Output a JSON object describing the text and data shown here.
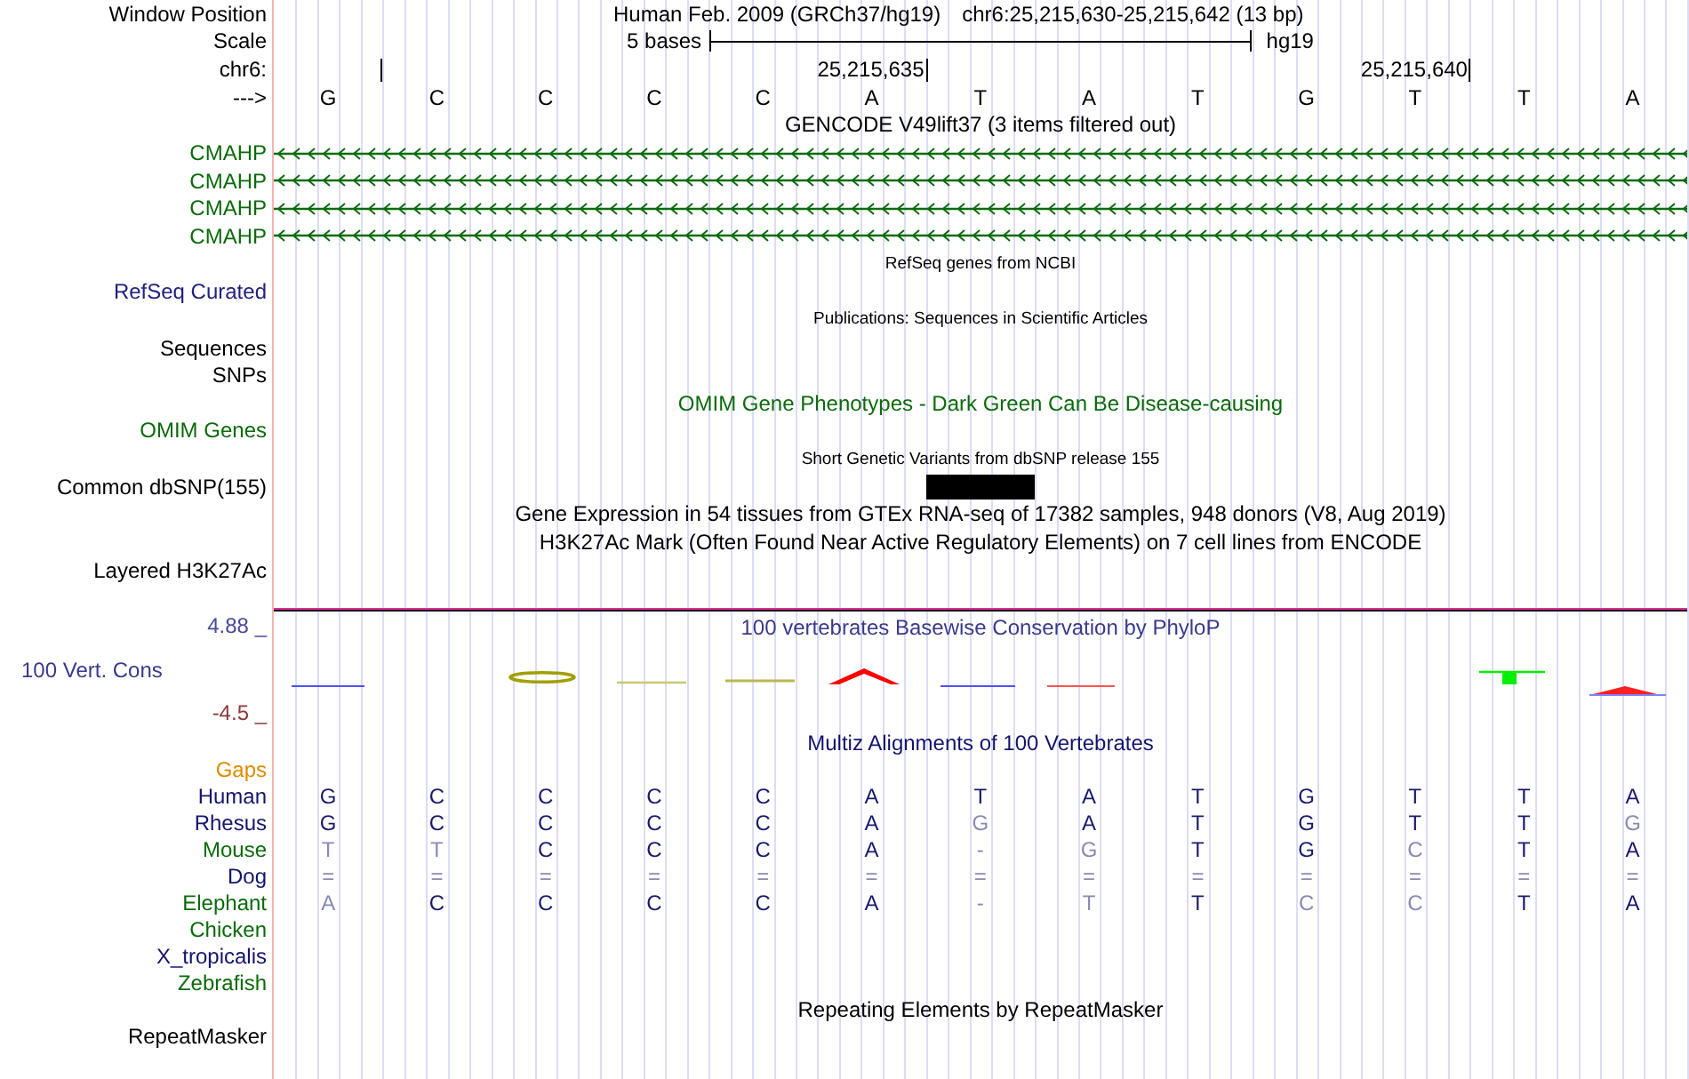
{
  "rows": [
    {
      "kind": "position",
      "label": "Window Position",
      "assembly": "Human Feb. 2009 (GRCh37/hg19)",
      "range": "chr6:25,215,630-25,215,642 (13 bp)"
    },
    {
      "kind": "scale",
      "label": "Scale",
      "text": "5 bases",
      "assembly": "hg19"
    },
    {
      "kind": "ruler",
      "label": "chr6:",
      "marks": [
        {
          "tick": true
        },
        {
          "tick": false
        },
        {
          "tick": false
        },
        {
          "tick": false
        },
        {
          "tick": false
        },
        {
          "tick": true,
          "label": "25,215,635"
        },
        {
          "tick": false
        },
        {
          "tick": false
        },
        {
          "tick": false
        },
        {
          "tick": false
        },
        {
          "tick": true,
          "label": "25,215,640"
        },
        {
          "tick": false
        },
        {
          "tick": false
        }
      ]
    },
    {
      "kind": "bases",
      "label": "--->",
      "bases": [
        "G",
        "C",
        "C",
        "C",
        "C",
        "A",
        "T",
        "A",
        "T",
        "G",
        "T",
        "T",
        "A"
      ]
    },
    {
      "kind": "title",
      "text": "GENCODE V49lift37 (3 items filtered out)",
      "color": "#000000"
    },
    {
      "kind": "gene",
      "label": "CMAHP",
      "color": "#0b6b0b"
    },
    {
      "kind": "gene",
      "label": "CMAHP",
      "color": "#0b6b0b"
    },
    {
      "kind": "gene",
      "label": "CMAHP",
      "color": "#0b6b0b"
    },
    {
      "kind": "gene",
      "label": "CMAHP",
      "color": "#0b6b0b"
    },
    {
      "kind": "note",
      "text": "RefSeq genes from NCBI"
    },
    {
      "kind": "label",
      "label": "RefSeq Curated",
      "color": "#202080"
    },
    {
      "kind": "note",
      "text": "Publications: Sequences in Scientific Articles"
    },
    {
      "kind": "label",
      "label": "Sequences",
      "color": "#000000"
    },
    {
      "kind": "label",
      "label": "SNPs",
      "color": "#000000"
    },
    {
      "kind": "title",
      "text": "OMIM Gene Phenotypes - Dark Green Can Be Disease-causing",
      "color": "#0b6b0b"
    },
    {
      "kind": "label",
      "label": "OMIM Genes",
      "color": "#0b6b0b"
    },
    {
      "kind": "note",
      "text": "Short Genetic Variants from dbSNP release 155"
    },
    {
      "kind": "snp",
      "label": "Common dbSNP(155)",
      "color": "#000000",
      "marks": [
        {
          "filled": false
        },
        {
          "filled": false
        },
        {
          "filled": false
        },
        {
          "filled": false
        },
        {
          "filled": false
        },
        {
          "filled": false
        },
        {
          "filled": true
        },
        {
          "filled": false
        },
        {
          "filled": false
        },
        {
          "filled": false
        },
        {
          "filled": false
        },
        {
          "filled": false
        },
        {
          "filled": false
        }
      ]
    },
    {
      "kind": "title",
      "text": "Gene Expression in 54 tissues from GTEx RNA-seq of 17382 samples, 948 donors (V8, Aug 2019)",
      "color": "#000000"
    },
    {
      "kind": "title",
      "text": "H3K27Ac Mark (Often Found Near Active Regulatory Elements) on 7 cell lines from ENCODE",
      "color": "#000000"
    },
    {
      "kind": "label",
      "label": "Layered H3K27Ac",
      "color": "#000000"
    },
    {
      "kind": "conservation",
      "label": "100 Vert. Cons",
      "color": "#3a3a8c",
      "max": "4.88 _",
      "min": "-4.5 _",
      "title": "100 vertebrates Basewise Conservation by PhyloP"
    },
    {
      "kind": "title",
      "text": "Multiz Alignments of 100 Vertebrates",
      "color": "#14146e"
    },
    {
      "kind": "label",
      "label": "Gaps",
      "color": "#e08a00"
    },
    {
      "kind": "alignment",
      "label": "Human",
      "color": "#14146e",
      "bases": [
        {
          "base": "G",
          "match": true
        },
        {
          "base": "C",
          "match": true
        },
        {
          "base": "C",
          "match": true
        },
        {
          "base": "C",
          "match": true
        },
        {
          "base": "C",
          "match": true
        },
        {
          "base": "A",
          "match": true
        },
        {
          "base": "T",
          "match": true
        },
        {
          "base": "A",
          "match": true
        },
        {
          "base": "T",
          "match": true
        },
        {
          "base": "G",
          "match": true
        },
        {
          "base": "T",
          "match": true
        },
        {
          "base": "T",
          "match": true
        },
        {
          "base": "A",
          "match": true
        }
      ]
    },
    {
      "kind": "alignment",
      "label": "Rhesus",
      "color": "#14146e",
      "bases": [
        {
          "base": "G",
          "match": true
        },
        {
          "base": "C",
          "match": true
        },
        {
          "base": "C",
          "match": true
        },
        {
          "base": "C",
          "match": true
        },
        {
          "base": "C",
          "match": true
        },
        {
          "base": "A",
          "match": true
        },
        {
          "base": "G",
          "match": false
        },
        {
          "base": "A",
          "match": true
        },
        {
          "base": "T",
          "match": true
        },
        {
          "base": "G",
          "match": true
        },
        {
          "base": "T",
          "match": true
        },
        {
          "base": "T",
          "match": true
        },
        {
          "base": "G",
          "match": false
        }
      ]
    },
    {
      "kind": "alignment",
      "label": "Mouse",
      "color": "#0b6b0b",
      "bases": [
        {
          "base": "T",
          "match": false
        },
        {
          "base": "T",
          "match": false
        },
        {
          "base": "C",
          "match": true
        },
        {
          "base": "C",
          "match": true
        },
        {
          "base": "C",
          "match": true
        },
        {
          "base": "A",
          "match": true
        },
        {
          "base": "-",
          "match": false
        },
        {
          "base": "G",
          "match": false
        },
        {
          "base": "T",
          "match": true
        },
        {
          "base": "G",
          "match": true
        },
        {
          "base": "C",
          "match": false
        },
        {
          "base": "T",
          "match": true
        },
        {
          "base": "A",
          "match": true
        }
      ]
    },
    {
      "kind": "alignment",
      "label": "Dog",
      "color": "#14146e",
      "bases": [
        {
          "base": "=",
          "match": false
        },
        {
          "base": "=",
          "match": false
        },
        {
          "base": "=",
          "match": false
        },
        {
          "base": "=",
          "match": false
        },
        {
          "base": "=",
          "match": false
        },
        {
          "base": "=",
          "match": false
        },
        {
          "base": "=",
          "match": false
        },
        {
          "base": "=",
          "match": false
        },
        {
          "base": "=",
          "match": false
        },
        {
          "base": "=",
          "match": false
        },
        {
          "base": "=",
          "match": false
        },
        {
          "base": "=",
          "match": false
        },
        {
          "base": "=",
          "match": false
        }
      ]
    },
    {
      "kind": "alignment",
      "label": "Elephant",
      "color": "#0b6b0b",
      "bases": [
        {
          "base": "A",
          "match": false
        },
        {
          "base": "C",
          "match": true
        },
        {
          "base": "C",
          "match": true
        },
        {
          "base": "C",
          "match": true
        },
        {
          "base": "C",
          "match": true
        },
        {
          "base": "A",
          "match": true
        },
        {
          "base": "-",
          "match": false
        },
        {
          "base": "T",
          "match": false
        },
        {
          "base": "T",
          "match": true
        },
        {
          "base": "C",
          "match": false
        },
        {
          "base": "C",
          "match": false
        },
        {
          "base": "T",
          "match": true
        },
        {
          "base": "A",
          "match": true
        }
      ]
    },
    {
      "kind": "label",
      "label": "Chicken",
      "color": "#0b6b0b"
    },
    {
      "kind": "label",
      "label": "X_tropicalis",
      "color": "#14146e"
    },
    {
      "kind": "label",
      "label": "Zebrafish",
      "color": "#0b6b0b"
    },
    {
      "kind": "title",
      "text": "Repeating Elements by RepeatMasker",
      "color": "#000000"
    },
    {
      "kind": "label",
      "label": "RepeatMasker",
      "color": "#000000"
    }
  ]
}
